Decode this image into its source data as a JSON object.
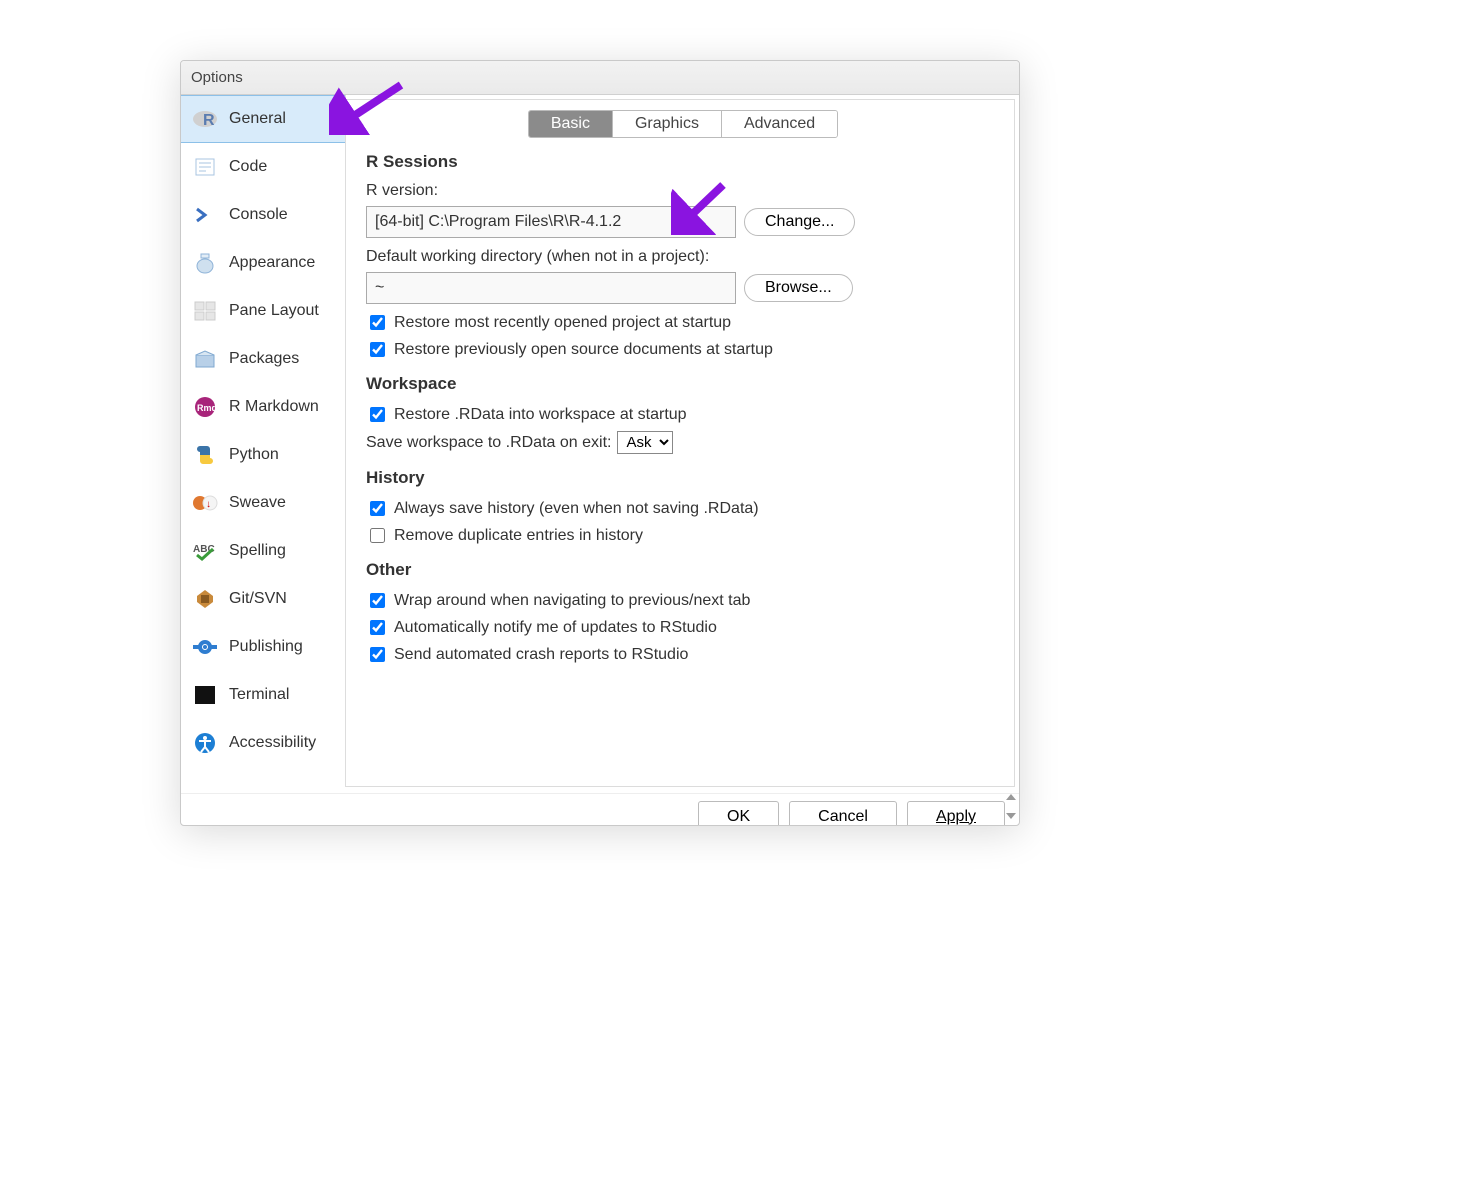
{
  "window": {
    "title": "Options"
  },
  "sidebar": {
    "items": [
      {
        "id": "general",
        "label": "General"
      },
      {
        "id": "code",
        "label": "Code"
      },
      {
        "id": "console",
        "label": "Console"
      },
      {
        "id": "appearance",
        "label": "Appearance"
      },
      {
        "id": "pane-layout",
        "label": "Pane Layout"
      },
      {
        "id": "packages",
        "label": "Packages"
      },
      {
        "id": "r-markdown",
        "label": "R Markdown"
      },
      {
        "id": "python",
        "label": "Python"
      },
      {
        "id": "sweave",
        "label": "Sweave"
      },
      {
        "id": "spelling",
        "label": "Spelling"
      },
      {
        "id": "git-svn",
        "label": "Git/SVN"
      },
      {
        "id": "publishing",
        "label": "Publishing"
      },
      {
        "id": "terminal",
        "label": "Terminal"
      },
      {
        "id": "accessibility",
        "label": "Accessibility"
      }
    ]
  },
  "tabs": {
    "basic": "Basic",
    "graphics": "Graphics",
    "advanced": "Advanced"
  },
  "sections": {
    "rsessions": "R Sessions",
    "workspace": "Workspace",
    "history": "History",
    "other": "Other"
  },
  "labels": {
    "r_version": "R version:",
    "default_wd": "Default working directory (when not in a project):",
    "save_ws": "Save workspace to .RData on exit:"
  },
  "fields": {
    "r_version_value": "[64-bit] C:\\Program Files\\R\\R-4.1.2",
    "default_wd_value": "~",
    "change_btn": "Change...",
    "browse_btn": "Browse...",
    "save_ws_value": "Ask"
  },
  "checks": {
    "restore_project": "Restore most recently opened project at startup",
    "restore_source": "Restore previously open source documents at startup",
    "restore_rdata": "Restore .RData into workspace at startup",
    "always_save_history": "Always save history (even when not saving .RData)",
    "remove_dup_history": "Remove duplicate entries in history",
    "wrap_tab": "Wrap around when navigating to previous/next tab",
    "notify_updates": "Automatically notify me of updates to RStudio",
    "crash_reports": "Send automated crash reports to RStudio"
  },
  "footer": {
    "ok": "OK",
    "cancel": "Cancel",
    "apply": "Apply"
  }
}
